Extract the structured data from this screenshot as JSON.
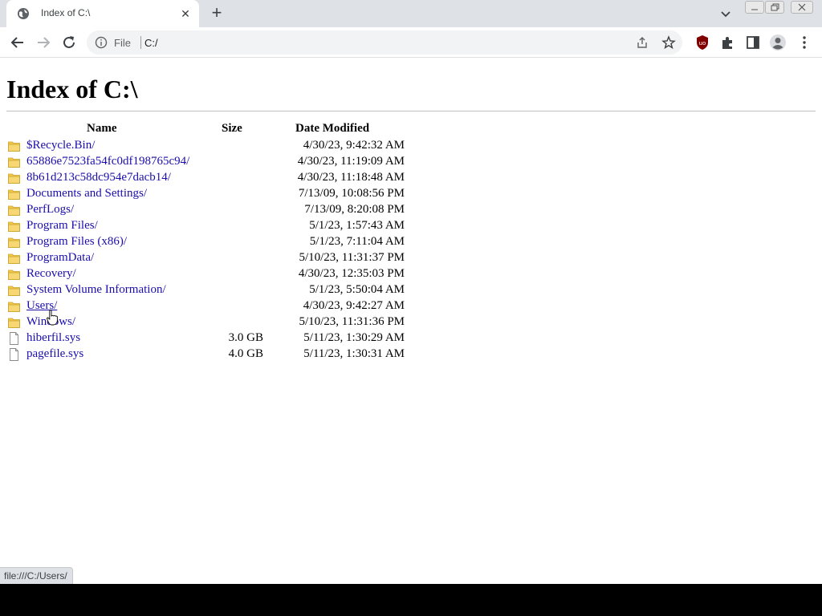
{
  "browser": {
    "tab_title": "Index of C:\\",
    "close_glyph": "✕",
    "newtab_glyph": "+",
    "scheme_label": "File",
    "url": "C:/"
  },
  "page": {
    "heading": "Index of C:\\",
    "columns": {
      "name": "Name",
      "size": "Size",
      "date": "Date Modified"
    },
    "entries": [
      {
        "name": "$Recycle.Bin/",
        "size": "",
        "date": "4/30/23, 9:42:32 AM",
        "type": "folder"
      },
      {
        "name": "65886e7523fa54fc0df198765c94/",
        "size": "",
        "date": "4/30/23, 11:19:09 AM",
        "type": "folder"
      },
      {
        "name": "8b61d213c58dc954e7dacb14/",
        "size": "",
        "date": "4/30/23, 11:18:48 AM",
        "type": "folder"
      },
      {
        "name": "Documents and Settings/",
        "size": "",
        "date": "7/13/09, 10:08:56 PM",
        "type": "folder"
      },
      {
        "name": "PerfLogs/",
        "size": "",
        "date": "7/13/09, 8:20:08 PM",
        "type": "folder"
      },
      {
        "name": "Program Files/",
        "size": "",
        "date": "5/1/23, 1:57:43 AM",
        "type": "folder"
      },
      {
        "name": "Program Files (x86)/",
        "size": "",
        "date": "5/1/23, 7:11:04 AM",
        "type": "folder"
      },
      {
        "name": "ProgramData/",
        "size": "",
        "date": "5/10/23, 11:31:37 PM",
        "type": "folder"
      },
      {
        "name": "Recovery/",
        "size": "",
        "date": "4/30/23, 12:35:03 PM",
        "type": "folder"
      },
      {
        "name": "System Volume Information/",
        "size": "",
        "date": "5/1/23, 5:50:04 AM",
        "type": "folder"
      },
      {
        "name": "Users/",
        "size": "",
        "date": "4/30/23, 9:42:27 AM",
        "type": "folder",
        "hovered": true
      },
      {
        "name": "Windows/",
        "size": "",
        "date": "5/10/23, 11:31:36 PM",
        "type": "folder"
      },
      {
        "name": "hiberfil.sys",
        "size": "3.0 GB",
        "date": "5/11/23, 1:30:29 AM",
        "type": "file"
      },
      {
        "name": "pagefile.sys",
        "size": "4.0 GB",
        "date": "5/11/23, 1:30:31 AM",
        "type": "file"
      }
    ]
  },
  "status_bar": {
    "text": "file:///C:/Users/"
  },
  "colors": {
    "link": "#1a0dab",
    "folder_icon": "#f2c94c",
    "tabstrip": "#dee1e6",
    "ublock_badge": "#800000"
  },
  "icons": [
    "globe-icon",
    "close-icon",
    "plus-icon",
    "chevron-down-icon",
    "minimize-icon",
    "restore-icon",
    "window-close-icon",
    "back-arrow-icon",
    "forward-arrow-icon",
    "reload-icon",
    "info-icon",
    "share-icon",
    "star-icon",
    "ublock-icon",
    "extensions-puzzle-icon",
    "side-panel-icon",
    "profile-avatar-icon",
    "kebab-menu-icon",
    "folder-icon",
    "file-icon",
    "hand-cursor-icon"
  ]
}
